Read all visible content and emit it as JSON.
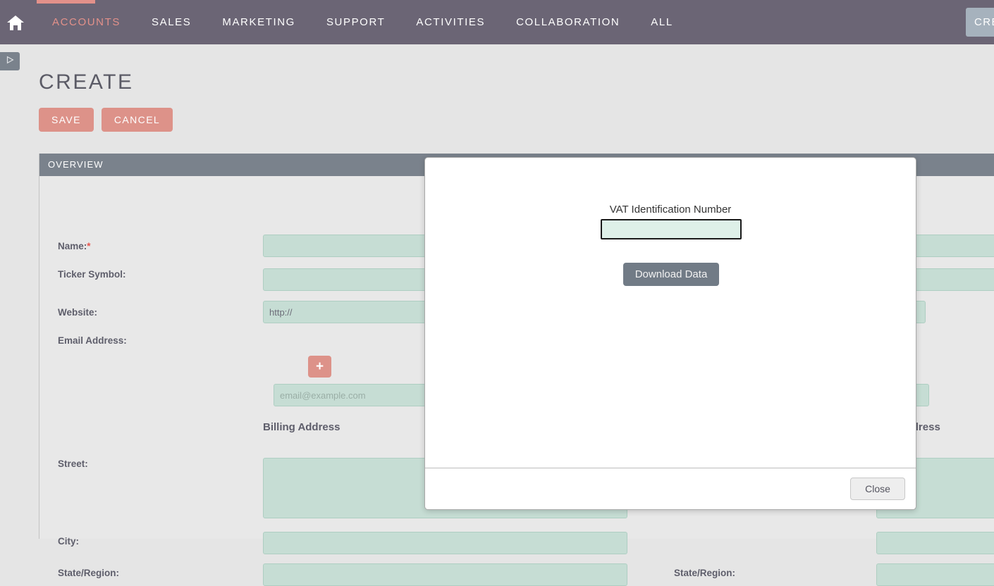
{
  "nav": {
    "home_icon": "home-icon",
    "items": [
      {
        "label": "ACCOUNTS",
        "active": true
      },
      {
        "label": "SALES",
        "active": false
      },
      {
        "label": "MARKETING",
        "active": false
      },
      {
        "label": "SUPPORT",
        "active": false
      },
      {
        "label": "ACTIVITIES",
        "active": false
      },
      {
        "label": "COLLABORATION",
        "active": false
      },
      {
        "label": "ALL",
        "active": false
      }
    ],
    "top_right_button": "CREATE",
    "bg_color": "#6b6575",
    "accent_color": "#e3918a"
  },
  "sidebar_toggle": {
    "icon": "play-triangle-icon"
  },
  "page": {
    "title": "CREATE",
    "save_label": "SAVE",
    "cancel_label": "CANCEL",
    "panel_header": "OVERVIEW"
  },
  "form": {
    "name_label": "Name:",
    "name_required": "*",
    "name_value": "",
    "ticker_label": "Ticker Symbol:",
    "ticker_value": "",
    "website_label": "Website:",
    "website_value": "http://",
    "email_label": "Email Address:",
    "email_add_button": "+",
    "email_placeholder": "email@example.com",
    "email_value": "",
    "billing_section": "Billing Address",
    "shipping_section": "Shipping Address",
    "street_label": "Street:",
    "street_value": "",
    "city_label": "City:",
    "city_value": "",
    "state_label": "State/Region:",
    "state_value": "",
    "shipping_state_label": "State/Region:",
    "shipping_state_value": ""
  },
  "modal": {
    "field_label": "VAT Identification Number",
    "field_value": "",
    "download_label": "Download Data",
    "close_label": "Close"
  }
}
